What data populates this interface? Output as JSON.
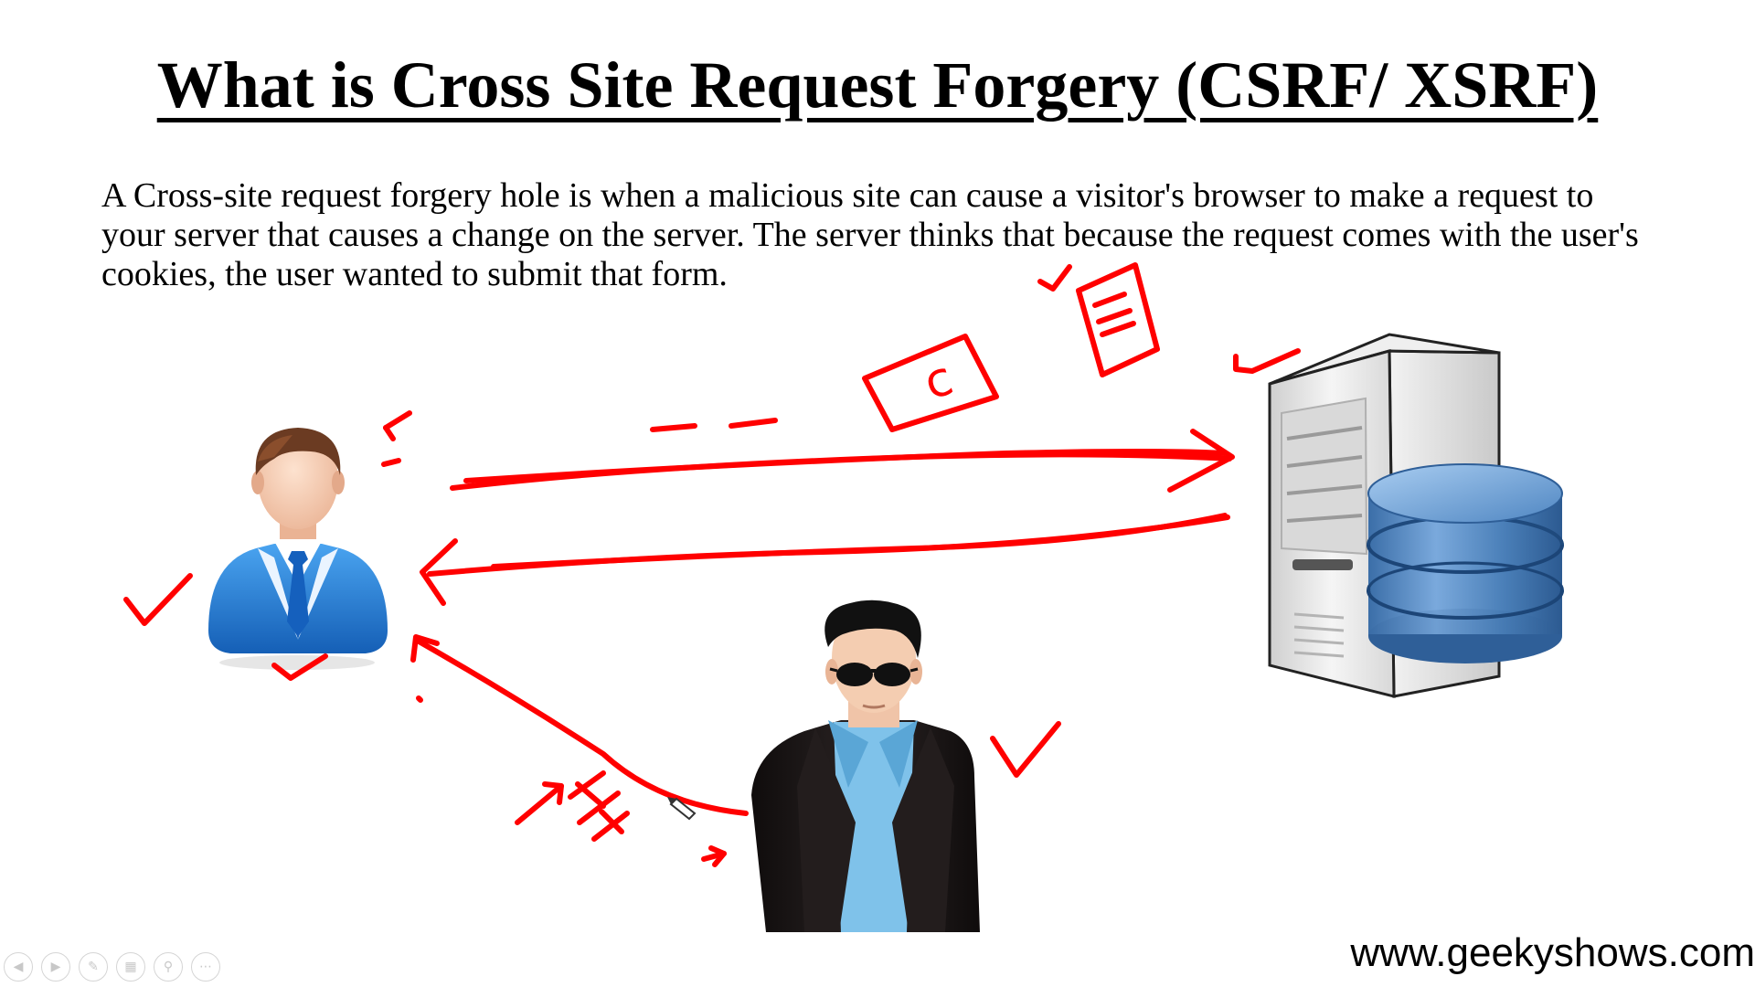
{
  "slide": {
    "title": "What is Cross Site Request Forgery (CSRF/ XSRF)",
    "description": "A Cross-site request forgery hole is when a malicious site can cause a visitor's browser to make a request to your server that causes a change on the server. The server thinks that because the request comes with the user's cookies, the user wanted to submit that form.",
    "footer_url": "www.geekyshows.com"
  },
  "annotations": {
    "cookie_label": "c",
    "ink_color": "#ff0000"
  },
  "colors": {
    "victim_suit": "#1e78d8",
    "victim_tie": "#1560bd",
    "attacker_jacket": "#1c1616",
    "attacker_shirt": "#7fc2ea",
    "server_body": "#e8e8e8",
    "database_blue": "#4a7fb8"
  },
  "toolbar": {
    "icons": [
      "previous-icon",
      "next-icon",
      "pen-icon",
      "slides-icon",
      "zoom-icon",
      "more-icon"
    ]
  }
}
